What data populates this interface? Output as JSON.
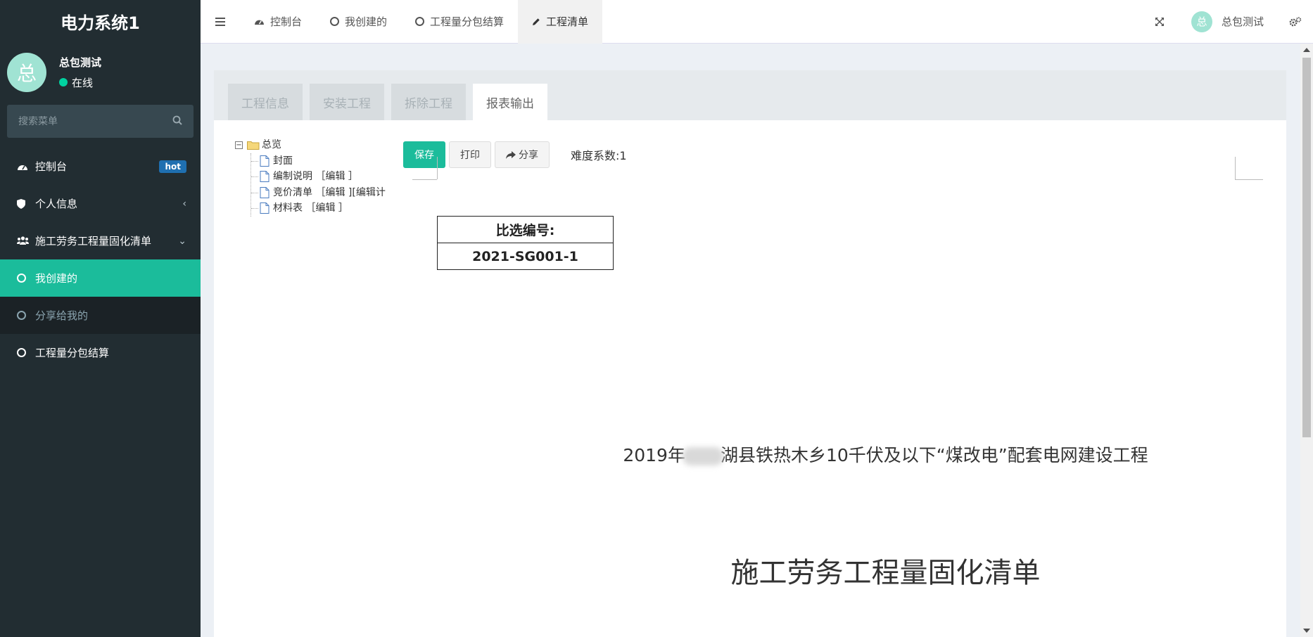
{
  "app": {
    "title": "电力系统1"
  },
  "user": {
    "name": "总包测试",
    "avatar_char": "总",
    "status": "在线"
  },
  "sidebar": {
    "search_placeholder": "搜索菜单",
    "items": [
      {
        "label": "控制台",
        "icon": "dashboard-icon",
        "badge": "hot"
      },
      {
        "label": "个人信息",
        "icon": "shield-icon"
      },
      {
        "label": "施工劳务工程量固化清单",
        "icon": "users-icon"
      },
      {
        "label": "我创建的",
        "icon": "circle-icon",
        "active": true
      },
      {
        "label": "分享给我的",
        "icon": "circle-icon"
      },
      {
        "label": "工程量分包结算",
        "icon": "circle-icon"
      }
    ]
  },
  "navbar": {
    "tabs": [
      {
        "label": "控制台",
        "icon": "dashboard-icon"
      },
      {
        "label": "我创建的",
        "icon": "circle-icon"
      },
      {
        "label": "工程量分包结算",
        "icon": "circle-icon"
      },
      {
        "label": "工程清单",
        "icon": "pencil-icon",
        "active": true
      }
    ],
    "user_name": "总包测试",
    "avatar_char": "总"
  },
  "content": {
    "tabs": [
      {
        "label": "工程信息"
      },
      {
        "label": "安装工程"
      },
      {
        "label": "拆除工程"
      },
      {
        "label": "报表输出",
        "active": true
      }
    ],
    "tree": {
      "root": "总览",
      "children": [
        {
          "label": "封面"
        },
        {
          "label": "编制说明 ［编辑 ］"
        },
        {
          "label": "竞价清单 ［编辑 ][编辑计"
        },
        {
          "label": "材料表 ［编辑 ］"
        }
      ]
    },
    "buttons": {
      "save": "保存",
      "print": "打印",
      "share": "分享"
    },
    "difficulty": "难度系数:1",
    "code_label": "比选编号:",
    "code_value": "2021-SG001-1",
    "project_prefix": "2019年",
    "project_suffix": "湖县铁热木乡10千伏及以下“煤改电”配套电网建设工程",
    "doc_title": "施工劳务工程量固化清单"
  },
  "colors": {
    "sidebar_bg": "#222d32",
    "accent": "#1bbc9b",
    "badge": "#1f6fb0"
  }
}
